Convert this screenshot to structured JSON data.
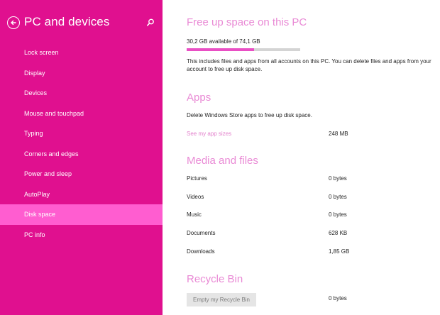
{
  "sidebar": {
    "title": "PC and devices",
    "items": [
      {
        "label": "Lock screen"
      },
      {
        "label": "Display"
      },
      {
        "label": "Devices"
      },
      {
        "label": "Mouse and touchpad"
      },
      {
        "label": "Typing"
      },
      {
        "label": "Corners and edges"
      },
      {
        "label": "Power and sleep"
      },
      {
        "label": "AutoPlay"
      },
      {
        "label": "Disk space",
        "selected": true
      },
      {
        "label": "PC info"
      }
    ],
    "icons": {
      "back": "back-arrow-icon",
      "search": "search-icon"
    }
  },
  "main": {
    "free_up": {
      "heading": "Free up space on this PC",
      "availability": "30,2 GB available of 74,1 GB",
      "used_fraction": 0.593,
      "description": "This includes files and apps from all accounts on this PC. You can delete files and apps from your account to free up disk space."
    },
    "apps": {
      "heading": "Apps",
      "description": "Delete Windows Store apps to free up disk space.",
      "link_label": "See my app sizes",
      "link_value": "248 MB"
    },
    "media": {
      "heading": "Media and files",
      "rows": [
        {
          "label": "Pictures",
          "value": "0 bytes"
        },
        {
          "label": "Videos",
          "value": "0 bytes"
        },
        {
          "label": "Music",
          "value": "0 bytes"
        },
        {
          "label": "Documents",
          "value": "628 KB"
        },
        {
          "label": "Downloads",
          "value": "1,85 GB"
        }
      ]
    },
    "recycle": {
      "heading": "Recycle Bin",
      "button_label": "Empty my Recycle Bin",
      "value": "0 bytes"
    }
  },
  "colors": {
    "sidebar_bg": "#e0108f",
    "selected_bg": "#ff5dd0",
    "heading": "#e98ad5",
    "link": "#e27fcb",
    "progress_fill": "#e94fc4",
    "progress_track": "#d4d4d4"
  }
}
